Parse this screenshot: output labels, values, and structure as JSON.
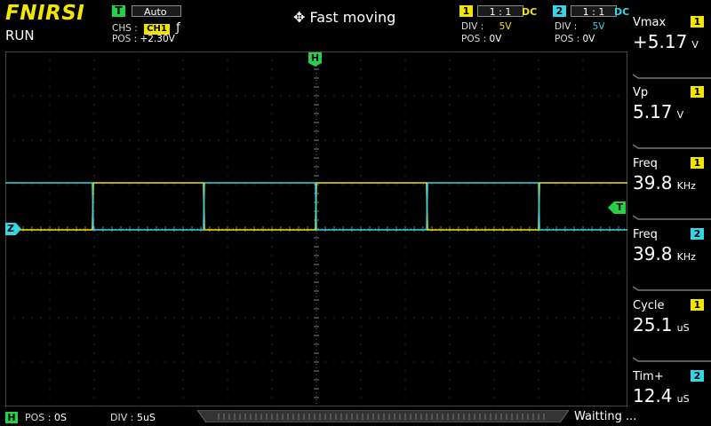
{
  "header": {
    "brand": "FNIRSI",
    "run_state": "RUN",
    "trigger_tag": "T",
    "trigger_mode": "Auto",
    "chs_label": "CHS :",
    "chs_value": "CH1",
    "edge_symbol": "ƒ",
    "pos_label": "POS :",
    "pos_value": "+2.30V",
    "mode_text": "Fast moving"
  },
  "ch1": {
    "num": "1",
    "ratio": "1 : 1",
    "coupling": "DC",
    "div_label": "DIV :",
    "div_value": "5V",
    "pos_label": "POS :",
    "pos_value": "0V",
    "color": "#f2e600"
  },
  "ch2": {
    "num": "2",
    "ratio": "1 : 1",
    "coupling": "DC",
    "div_label": "DIV :",
    "div_value": "5V",
    "pos_label": "POS :",
    "pos_value": "0V",
    "color": "#34d6e6"
  },
  "markers": {
    "h_marker": "H",
    "t_marker": "T",
    "z_marker": "Z"
  },
  "measurements": [
    {
      "label": "Vmax",
      "value": "+5.17",
      "unit": "V",
      "channel": "1"
    },
    {
      "label": "Vp",
      "value": "5.17",
      "unit": "V",
      "channel": "1"
    },
    {
      "label": "Freq",
      "value": "39.8",
      "unit": "KHz",
      "channel": "1"
    },
    {
      "label": "Freq",
      "value": "39.8",
      "unit": "KHz",
      "channel": "2"
    },
    {
      "label": "Cycle",
      "value": "25.1",
      "unit": "uS",
      "channel": "1"
    },
    {
      "label": "Tim+",
      "value": "12.4",
      "unit": "uS",
      "channel": "2"
    }
  ],
  "footer": {
    "h_tag": "H",
    "pos_label": "POS :",
    "pos_value": "0S",
    "div_label": "DIV :",
    "div_value": "5uS",
    "status": "Waitting ..."
  }
}
